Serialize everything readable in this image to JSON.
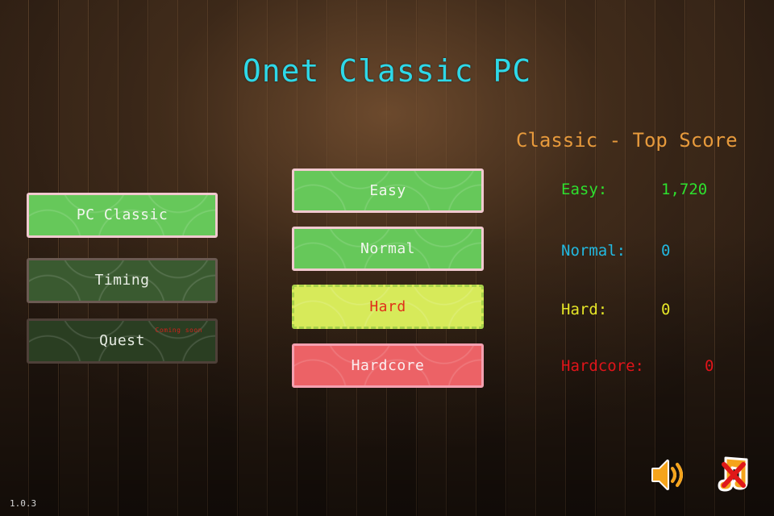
{
  "title": "Onet Classic PC",
  "modes": [
    {
      "label": "PC Classic",
      "state": "selected"
    },
    {
      "label": "Timing",
      "state": "normal"
    },
    {
      "label": "Quest",
      "state": "disabled",
      "badge": "Coming soon"
    }
  ],
  "difficulties": [
    {
      "label": "Easy"
    },
    {
      "label": "Normal"
    },
    {
      "label": "Hard",
      "selected": true
    },
    {
      "label": "Hardcore"
    }
  ],
  "scores": {
    "title": "Classic - Top Score",
    "rows": [
      {
        "label": "Easy:",
        "value": "1,720",
        "color": "#2ee02e"
      },
      {
        "label": "Normal:",
        "value": "0",
        "color": "#22b8e0"
      },
      {
        "label": "Hard:",
        "value": "0",
        "color": "#e6e628"
      },
      {
        "label": "Hardcore:",
        "value": "0",
        "color": "#e0141a"
      }
    ]
  },
  "controls": {
    "sound_icon": "speaker-icon",
    "music_icon": "music-off-icon"
  },
  "version": "1.0.3",
  "colors": {
    "title": "#2ed8e8",
    "score_title": "#e79a3c"
  }
}
